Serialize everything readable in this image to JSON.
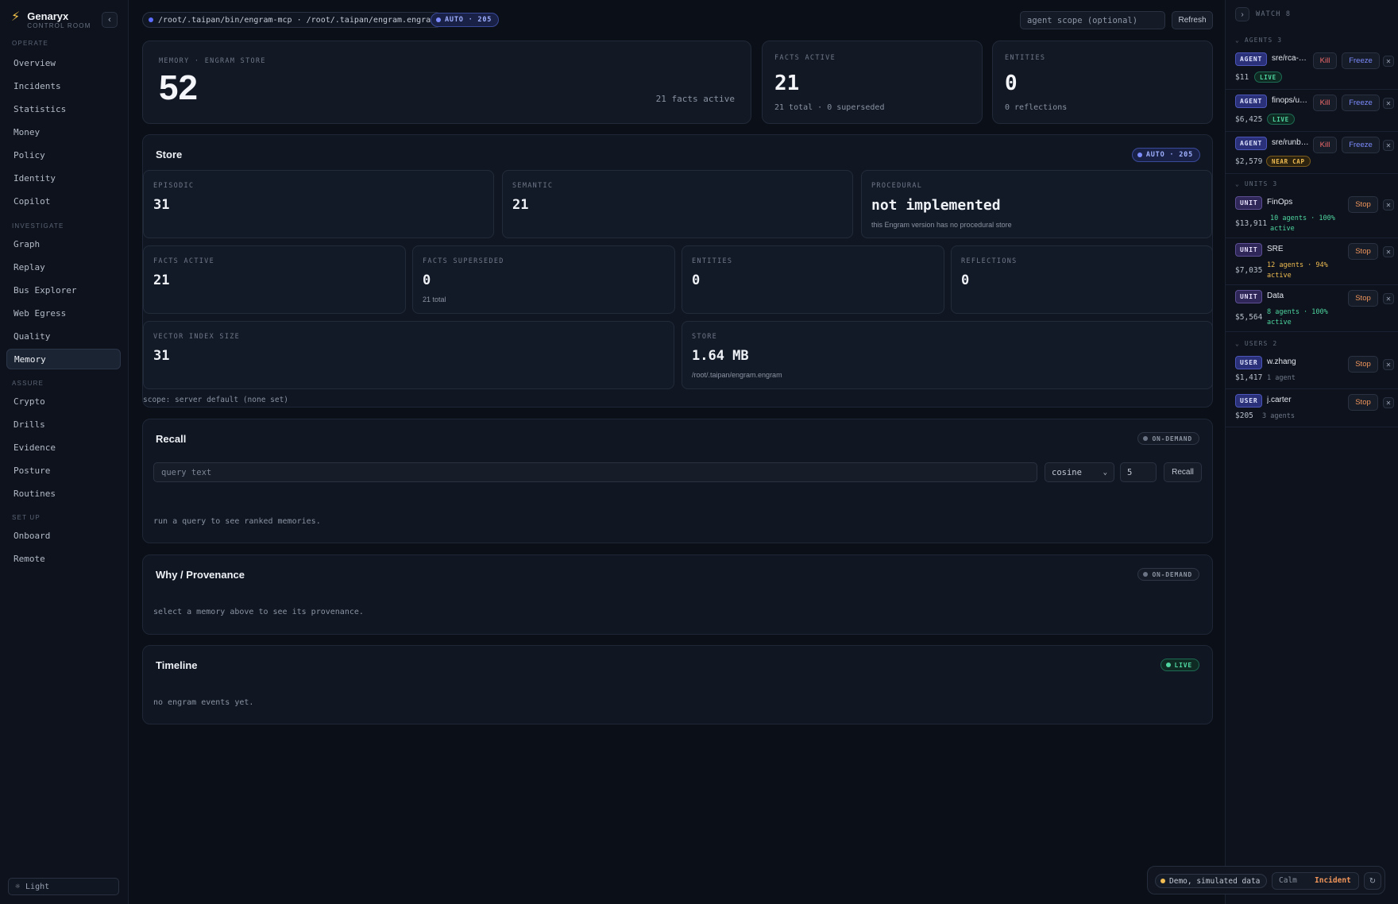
{
  "brand": {
    "name": "Genaryx",
    "sub": "CONTROL ROOM"
  },
  "nav": {
    "sections": [
      {
        "label": "OPERATE",
        "items": [
          "Overview",
          "Incidents",
          "Statistics",
          "Money",
          "Policy",
          "Identity",
          "Copilot"
        ]
      },
      {
        "label": "INVESTIGATE",
        "items": [
          "Graph",
          "Replay",
          "Bus Explorer",
          "Web Egress",
          "Quality",
          "Memory"
        ]
      },
      {
        "label": "ASSURE",
        "items": [
          "Crypto",
          "Drills",
          "Evidence",
          "Posture",
          "Routines"
        ]
      },
      {
        "label": "SET UP",
        "items": [
          "Onboard",
          "Remote"
        ]
      }
    ],
    "active": "Memory",
    "theme_toggle": "Light"
  },
  "topbar": {
    "path": "/root/.taipan/bin/engram-mcp · /root/.taipan/engram.engram",
    "auto_badge": "AUTO · 205",
    "scope_placeholder": "agent scope (optional)",
    "refresh": "Refresh"
  },
  "summary": {
    "memory": {
      "label": "MEMORY · ENGRAM STORE",
      "value": "52",
      "note": "21 facts active"
    },
    "facts_active": {
      "label": "FACTS ACTIVE",
      "value": "21",
      "note": "21 total · 0 superseded"
    },
    "entities": {
      "label": "ENTITIES",
      "value": "0",
      "note": "0 reflections"
    }
  },
  "store": {
    "title": "Store",
    "badge": "AUTO · 205",
    "row1": [
      {
        "label": "EPISODIC",
        "value": "31",
        "sub": ""
      },
      {
        "label": "SEMANTIC",
        "value": "21",
        "sub": ""
      },
      {
        "label": "PROCEDURAL",
        "value": "not implemented",
        "sub": "this Engram version has no procedural store"
      }
    ],
    "row2": [
      {
        "label": "FACTS ACTIVE",
        "value": "21",
        "sub": ""
      },
      {
        "label": "FACTS SUPERSEDED",
        "value": "0",
        "sub": "21 total"
      },
      {
        "label": "ENTITIES",
        "value": "0",
        "sub": ""
      },
      {
        "label": "REFLECTIONS",
        "value": "0",
        "sub": ""
      }
    ],
    "row3": [
      {
        "label": "VECTOR INDEX SIZE",
        "value": "31",
        "sub": ""
      },
      {
        "label": "STORE",
        "value": "1.64 MB",
        "sub": "/root/.taipan/engram.engram"
      }
    ],
    "scope": "scope: server default (none set)"
  },
  "recall": {
    "title": "Recall",
    "badge": "ON-DEMAND",
    "query_placeholder": "query text",
    "metric": "cosine",
    "k": "5",
    "button": "Recall",
    "hint": "run a query to see ranked memories."
  },
  "why": {
    "title": "Why / Provenance",
    "badge": "ON-DEMAND",
    "hint": "select a memory above to see its provenance."
  },
  "timeline": {
    "title": "Timeline",
    "badge": "LIVE",
    "hint": "no engram events yet."
  },
  "watch": {
    "title": "WATCH 8",
    "agents_label": "AGENTS 3",
    "agents": [
      {
        "tag": "AGENT",
        "name": "sre/rca-…",
        "cost": "$11",
        "status": "LIVE"
      },
      {
        "tag": "AGENT",
        "name": "finops/u…",
        "cost": "$6,425",
        "status": "LIVE"
      },
      {
        "tag": "AGENT",
        "name": "sre/runb…",
        "cost": "$2,579",
        "status": "NEAR CAP"
      }
    ],
    "agent_kill": "Kill",
    "agent_freeze": "Freeze",
    "units_label": "UNITS 3",
    "units": [
      {
        "tag": "UNIT",
        "name": "FinOps",
        "cost": "$13,911",
        "meta": "10 agents · 100% active",
        "meta_color": "#4fd6a0"
      },
      {
        "tag": "UNIT",
        "name": "SRE",
        "cost": "$7,035",
        "meta": "12 agents · 94% active",
        "meta_color": "#f1bd52"
      },
      {
        "tag": "UNIT",
        "name": "Data",
        "cost": "$5,564",
        "meta": "8 agents · 100% active",
        "meta_color": "#4fd6a0"
      }
    ],
    "users_label": "USERS 2",
    "users": [
      {
        "tag": "USER",
        "name": "w.zhang",
        "cost": "$1,417",
        "meta": "1 agent"
      },
      {
        "tag": "USER",
        "name": "j.carter",
        "cost": "$205",
        "meta": "3 agents"
      }
    ],
    "stop": "Stop"
  },
  "demo": {
    "label": "Demo, simulated data",
    "calm": "Calm",
    "incident": "Incident"
  }
}
